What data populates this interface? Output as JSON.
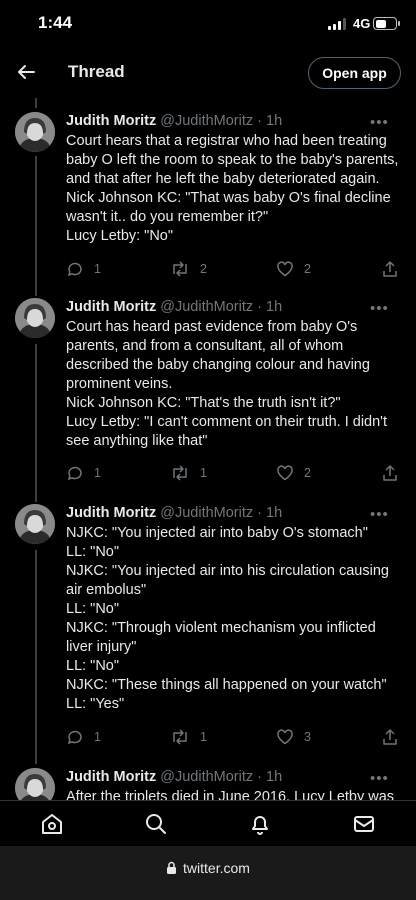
{
  "status_bar": {
    "time": "1:44",
    "network": "4G",
    "battery_level": 0.6
  },
  "header": {
    "title": "Thread",
    "open_app_label": "Open app",
    "back_icon": "arrow-left-icon"
  },
  "tweets": [
    {
      "name": "Judith Moritz",
      "handle": "@JudithMoritz · 1h",
      "lines": [
        "Court hears that a registrar who had been treating",
        "baby O left the room to speak to the baby's parents,",
        "and that after he left the baby deteriorated again.",
        "Nick Johnson KC: \"That was baby O's final decline",
        "wasn't it.. do you remember it?\"",
        "Lucy Letby: \"No\""
      ],
      "replies": "1",
      "retweets": "2",
      "likes": "2"
    },
    {
      "name": "Judith Moritz",
      "handle": "@JudithMoritz · 1h",
      "lines": [
        "Court has heard past evidence from baby O's",
        "parents, and from a consultant, all of whom",
        "described the baby changing colour and having",
        "prominent veins.",
        "Nick Johnson KC: \"That's the truth isn't it?\"",
        "Lucy Letby: \"I can't comment on their truth. I didn't",
        "see anything like that\""
      ],
      "replies": "1",
      "retweets": "1",
      "likes": "2"
    },
    {
      "name": "Judith Moritz",
      "handle": "@JudithMoritz · 1h",
      "lines": [
        "NJKC: \"You injected air into baby O's stomach\"",
        "LL: \"No\"",
        "NJKC: \"You injected air into his circulation causing",
        "air embolus\"",
        "LL: \"No\"",
        "NJKC: \"Through violent mechanism you inflicted",
        "liver injury\"",
        "LL: \"No\"",
        "NJKC: \"These things all happened on your watch\"",
        "LL: \"Yes\""
      ],
      "replies": "1",
      "retweets": "1",
      "likes": "3"
    },
    {
      "name": "Judith Moritz",
      "handle": "@JudithMoritz · 1h",
      "lines": [
        "After the triplets died in June 2016, Lucy Letby was"
      ]
    }
  ],
  "bottom_nav": [
    "home-icon",
    "search-icon",
    "notifications-icon",
    "messages-icon"
  ],
  "url_bar": {
    "url": "twitter.com"
  }
}
